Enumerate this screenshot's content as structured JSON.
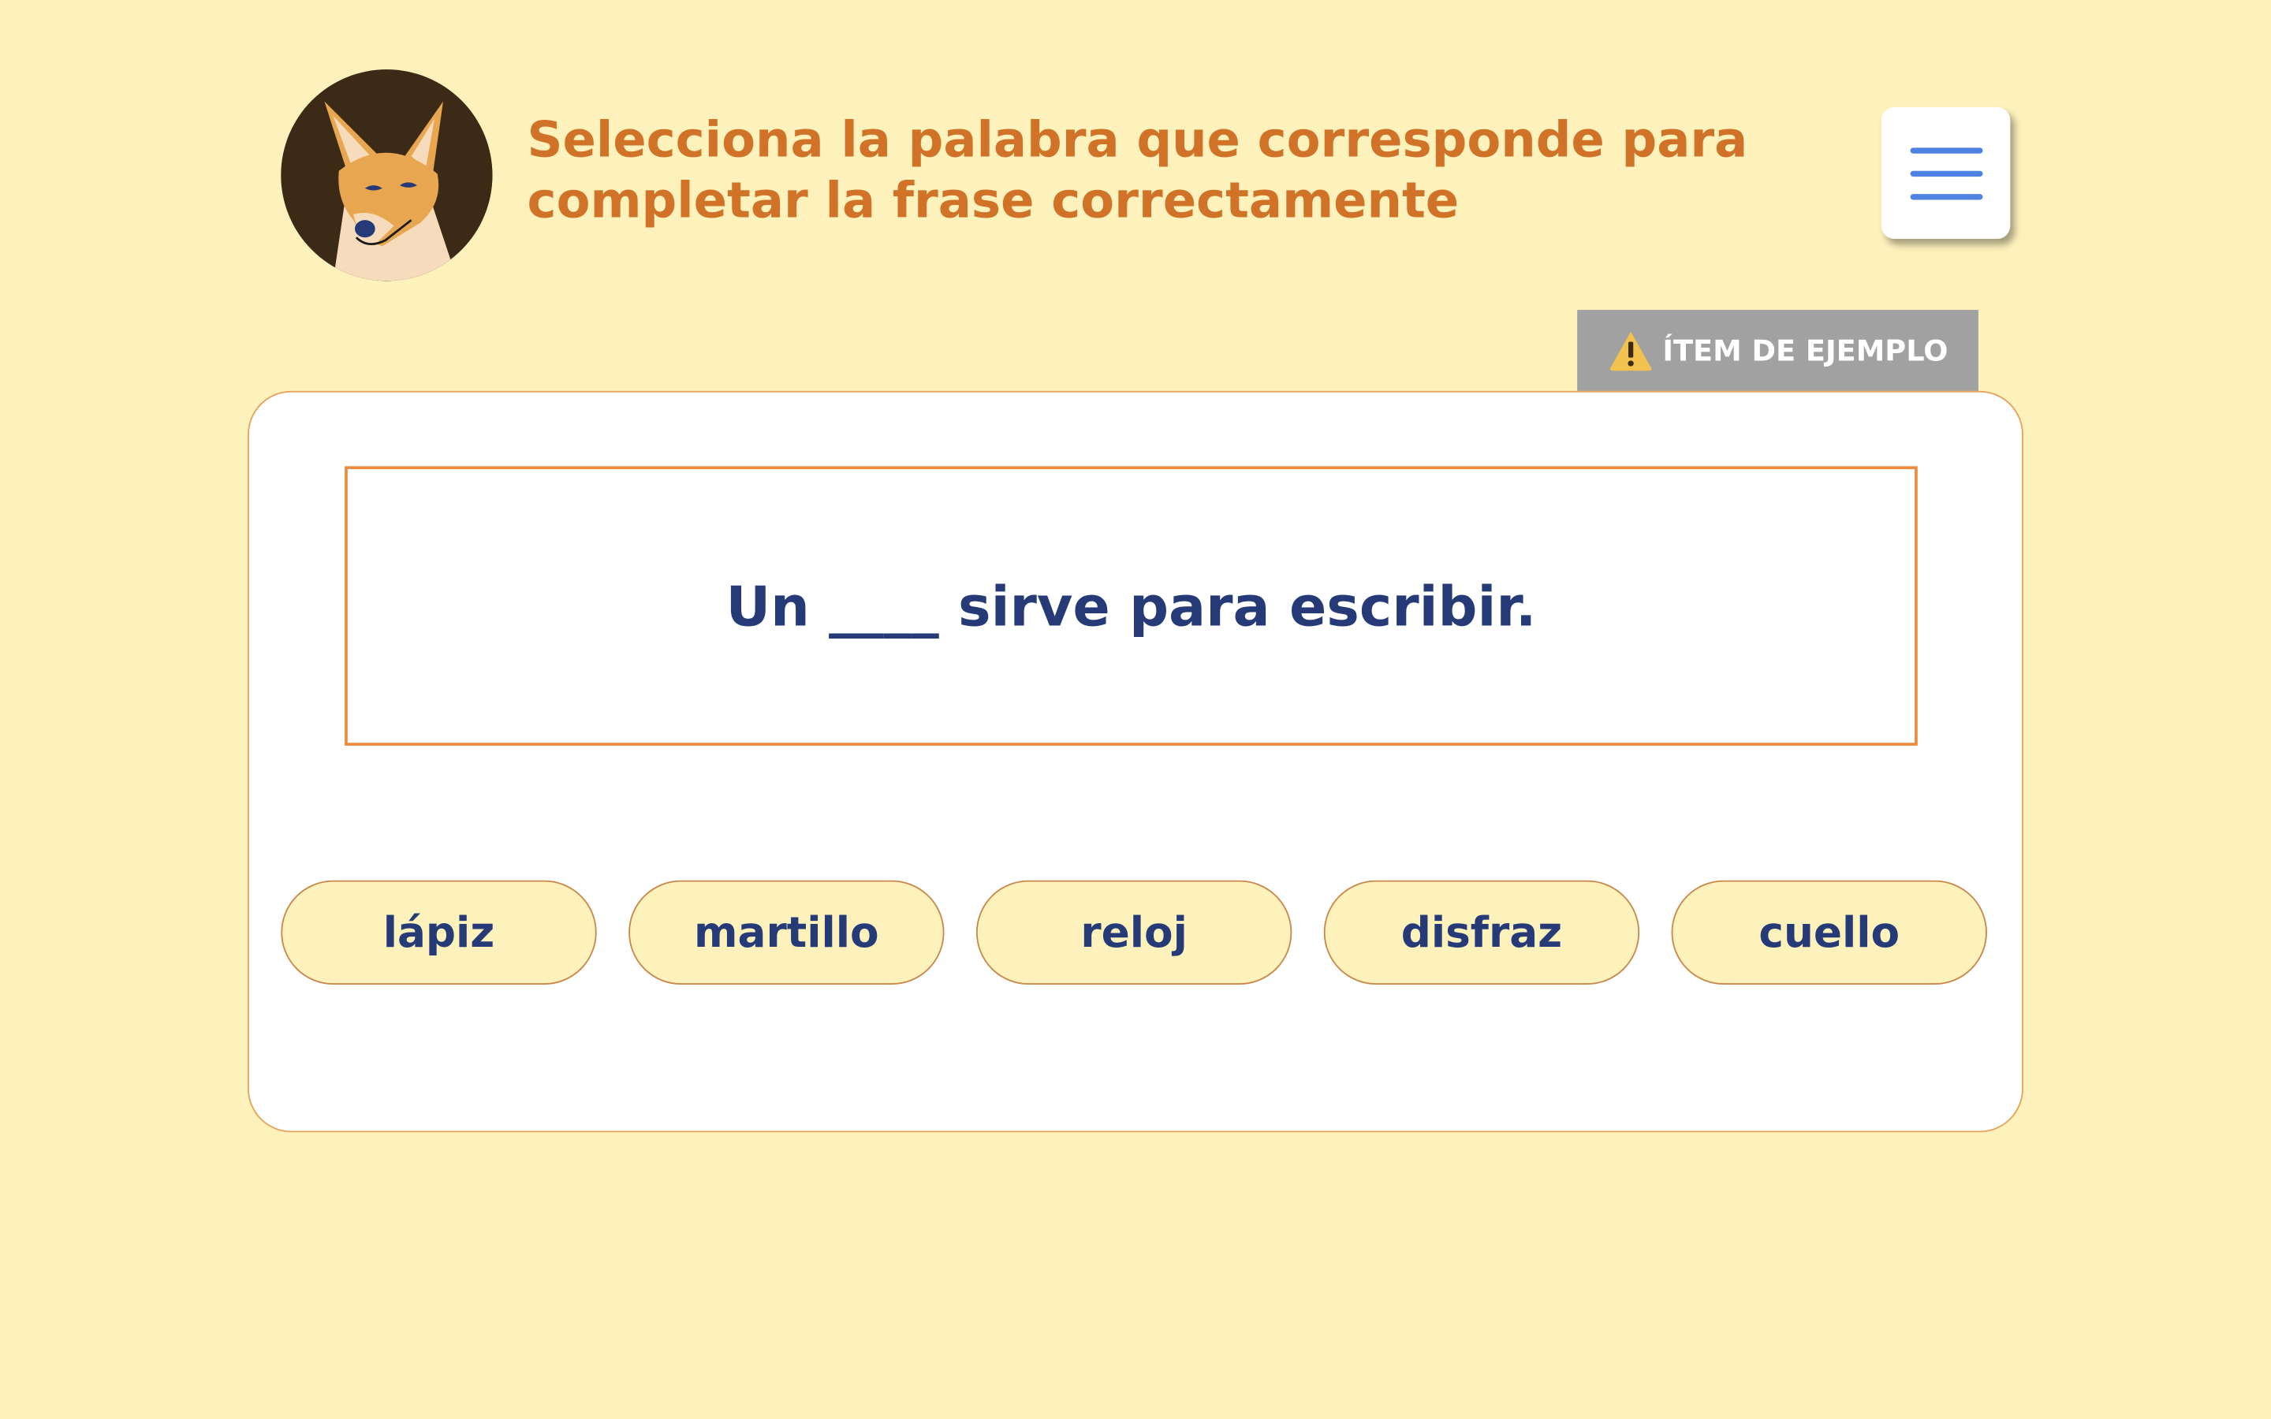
{
  "header": {
    "avatar_icon": "fox-avatar-icon",
    "instruction": "Selecciona la palabra que corresponde para completar la frase correctamente",
    "menu_icon": "hamburger-menu-icon"
  },
  "badge": {
    "icon": "warning-icon",
    "label": "ÍTEM DE EJEMPLO"
  },
  "question": {
    "sentence": "Un ____ sirve para escribir."
  },
  "options": [
    {
      "label": "lápiz"
    },
    {
      "label": "martillo"
    },
    {
      "label": "reloj"
    },
    {
      "label": "disfraz"
    },
    {
      "label": "cuello"
    }
  ],
  "colors": {
    "background": "#fdf1bc",
    "instruction_text": "#d07228",
    "sentence_text": "#263a78",
    "box_border": "#ee8a3a",
    "menu_icon": "#4f83e3",
    "badge_bg": "#a1a1a1"
  }
}
